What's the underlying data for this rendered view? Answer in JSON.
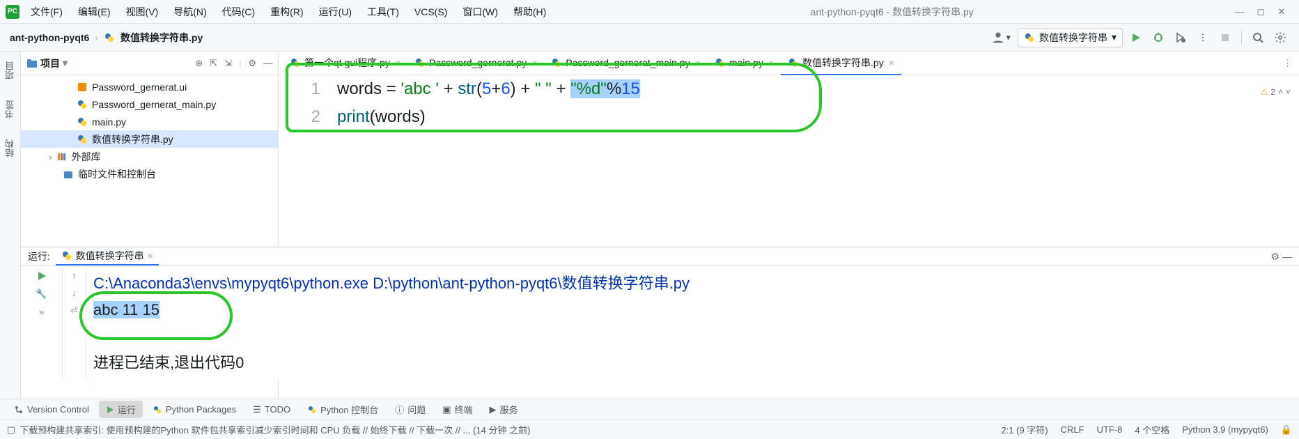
{
  "menu": {
    "file": "文件(F)",
    "edit": "编辑(E)",
    "view": "视图(V)",
    "nav": "导航(N)",
    "code": "代码(C)",
    "refactor": "重构(R)",
    "run": "运行(U)",
    "tools": "工具(T)",
    "vcs": "VCS(S)",
    "window": "窗口(W)",
    "help": "帮助(H)"
  },
  "title_project": "ant-python-pyqt6",
  "title_file": "数值转换字符串.py",
  "crumbs": {
    "project": "ant-python-pyqt6",
    "file": "数值转换字符串.py"
  },
  "run_config_label": "数值转换字符串",
  "project_panel": {
    "title": "项目"
  },
  "tree": {
    "f1": "Password_gernerat.ui",
    "f2": "Password_gernerat_main.py",
    "f3": "main.py",
    "f4": "数值转换字符串.py",
    "lib": "外部库",
    "scratch": "临时文件和控制台"
  },
  "tabs": {
    "t1": "第一个qt gui程序.py",
    "t2": "Password_gernerat.py",
    "t3": "Password_gernerat_main.py",
    "t4": "main.py",
    "t5": "数值转换字符串.py"
  },
  "code": {
    "l1_a": "words = ",
    "l1_s1": "'abc '",
    "l1_b": " + ",
    "l1_fn": "str",
    "l1_c": "(",
    "l1_n1": "5",
    "l1_d": "+",
    "l1_n2": "6",
    "l1_e": ") + ",
    "l1_s2": "\" \"",
    "l1_f": " + ",
    "l1_s3": "\"%d\"",
    "l1_g": "%",
    "l1_n3": "15",
    "l2_a": "print",
    "l2_b": "(words)"
  },
  "gutter": {
    "l1": "1",
    "l2": "2"
  },
  "inspect": {
    "count": "2"
  },
  "sidebar": {
    "project": "项目",
    "bookmarks": "书签",
    "structure": "结构"
  },
  "run_panel": {
    "label": "运行:",
    "tab": "数值转换字符串"
  },
  "console": {
    "cmd": "C:\\Anaconda3\\envs\\mypyqt6\\python.exe D:\\python\\ant-python-pyqt6\\数值转换字符串.py",
    "out": "abc 11 15",
    "exit": "进程已结束,退出代码0"
  },
  "bottom": {
    "vc": "Version Control",
    "run": "运行",
    "pkg": "Python Packages",
    "todo": "TODO",
    "pyc": "Python 控制台",
    "prob": "问题",
    "term": "终端",
    "svc": "服务"
  },
  "status": {
    "msg": "下载预构建共享索引: 使用预构建的Python 软件包共享索引减少索引时间和 CPU 负载 // 始终下载 // 下载一次 // ... (14 分钟 之前)",
    "pos": "2:1 (9 字符)",
    "crlf": "CRLF",
    "enc": "UTF-8",
    "indent": "4 个空格",
    "py": "Python 3.9 (mypyqt6)"
  }
}
